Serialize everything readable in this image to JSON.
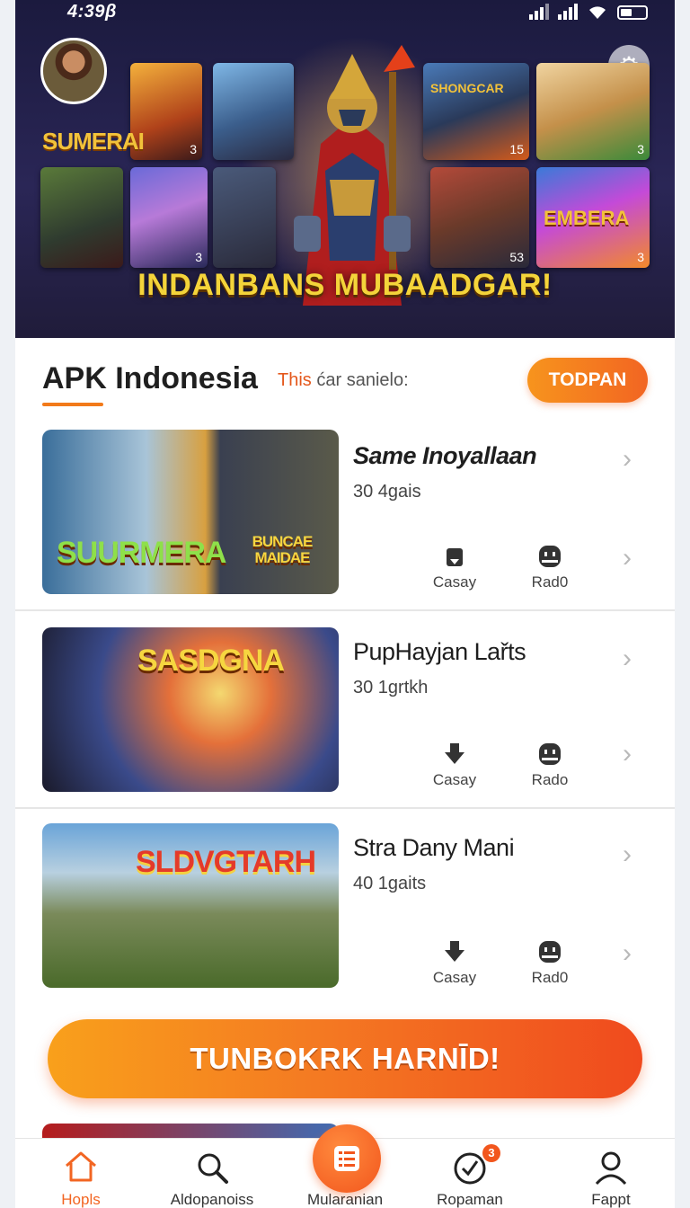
{
  "status_bar": {
    "time": "4:39β"
  },
  "hero": {
    "logo_text": "SUMERAI",
    "banner": "INDANBANS MUBAADGAR!",
    "tiles": [
      {
        "label": "",
        "count": "3"
      },
      {
        "label": "SHONGCAR",
        "count": "15"
      },
      {
        "label": "",
        "count": "3"
      },
      {
        "label": "",
        "count": "3"
      },
      {
        "label": "",
        "count": "53"
      },
      {
        "label": "EMBERA",
        "count": "3"
      }
    ]
  },
  "section": {
    "title": "APK Indonesia",
    "sub_highlight": "This",
    "sub_rest": " ćar sanielo:",
    "button": "TODPAN"
  },
  "cards": [
    {
      "title": "Same Inoyallaan",
      "meta": "30 4gais",
      "thumb_text_a": "SUURMERA",
      "thumb_text_b": "BUNCAE MAIDAE",
      "action1": "Casay",
      "action2": "Rad0"
    },
    {
      "title": "PupHayjan Lařts",
      "meta": "30 1grtkh",
      "thumb_text_a": "SASDGNA",
      "thumb_text_b": "",
      "action1": "Casay",
      "action2": "Rado"
    },
    {
      "title": "Stra Dany Mani",
      "meta": "40 1gaits",
      "thumb_text_a": "SLDVGTARH",
      "thumb_text_b": "",
      "action1": "Casay",
      "action2": "Rad0"
    }
  ],
  "cta": {
    "label": "TUNBOKRK HARNĪD!"
  },
  "bottom_nav": {
    "items": [
      {
        "label": "Hopls",
        "icon": "home-icon",
        "active": true
      },
      {
        "label": "Aldopanoiss",
        "icon": "search-icon",
        "active": false
      },
      {
        "label": "Mularanian",
        "icon": "list-icon",
        "active": false
      },
      {
        "label": "Ropaman",
        "icon": "check-icon",
        "active": false,
        "badge": "3"
      },
      {
        "label": "Fappt",
        "icon": "profile-icon",
        "active": false
      }
    ]
  },
  "colors": {
    "accent": "#f26522",
    "accent_light": "#f7941d",
    "banner_text": "#f4d43a"
  }
}
